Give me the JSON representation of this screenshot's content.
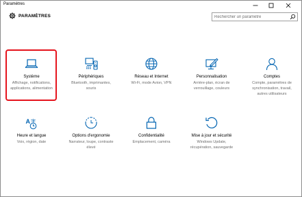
{
  "window": {
    "title": "Paramètres",
    "minimize_symbol": "–",
    "maximize_symbol": "□",
    "close_symbol": "✕"
  },
  "header": {
    "title": "PARAMÈTRES",
    "search_placeholder": "Rechercher un paramètre"
  },
  "accent_color": "#0063b1",
  "selection_color": "#e5131c",
  "tiles": [
    {
      "icon": "laptop-icon",
      "name": "Système",
      "desc": "Affichage, notifications, applications, alimentation",
      "selected": true
    },
    {
      "icon": "devices-icon",
      "name": "Périphériques",
      "desc": "Bluetooth, imprimantes, souris"
    },
    {
      "icon": "globe-icon",
      "name": "Réseau et Internet",
      "desc": "Wi-Fi, mode Avion, VPN"
    },
    {
      "icon": "personalization-icon",
      "name": "Personnalisation",
      "desc": "Arrière-plan, écran de verrouillage, couleurs"
    },
    {
      "icon": "person-icon",
      "name": "Comptes",
      "desc": "Compte, paramètres de synchronisation, travail, autres utilisateurs"
    },
    {
      "icon": "time-language-icon",
      "name": "Heure et langue",
      "desc": "Voix, région, date"
    },
    {
      "icon": "ease-of-access-icon",
      "name": "Options d'ergonomie",
      "desc": "Narrateur, loupe, contraste élevé"
    },
    {
      "icon": "lock-icon",
      "name": "Confidentialité",
      "desc": "Emplacement, caméra"
    },
    {
      "icon": "update-icon",
      "name": "Mise à jour et sécurité",
      "desc": "Windows Update, récupération, sauvegarde"
    }
  ]
}
